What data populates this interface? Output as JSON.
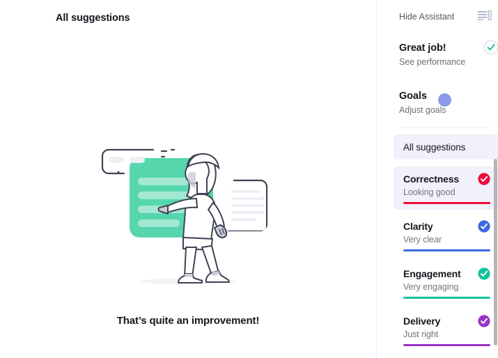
{
  "main": {
    "page_title": "All suggestions",
    "caption": "That’s quite an improvement!",
    "illustration_name": "woman-pointing-at-document-cards-illustration"
  },
  "sidebar": {
    "hide_assistant": {
      "label": "Hide Assistant",
      "icon": "panel-layout-icon"
    },
    "status_blocks": [
      {
        "id": "great-job",
        "title": "Great job!",
        "subtitle": "See performance",
        "icon": "check-circle-outline-icon",
        "icon_color": "#1fc39a"
      },
      {
        "id": "goals",
        "title": "Goals",
        "subtitle": "Adjust goals",
        "icon": "dot-icon",
        "icon_color": "#8a9ae8"
      }
    ],
    "all_suggestions": {
      "label": "All suggestions",
      "active": true
    },
    "metrics": [
      {
        "id": "correctness",
        "title": "Correctness",
        "subtitle": "Looking good",
        "badge": "check-badge-icon",
        "color": "#ed0c3a",
        "active": true
      },
      {
        "id": "clarity",
        "title": "Clarity",
        "subtitle": "Very clear",
        "badge": "check-badge-icon",
        "color": "#3d6ae0",
        "active": false
      },
      {
        "id": "engagement",
        "title": "Engagement",
        "subtitle": "Very engaging",
        "badge": "check-badge-icon",
        "color": "#15c39a",
        "active": false
      },
      {
        "id": "delivery",
        "title": "Delivery",
        "subtitle": "Just right",
        "badge": "check-badge-icon",
        "color": "#9b34c6",
        "active": false
      }
    ],
    "scrollbar": {
      "name": "sidebar-scrollbar"
    }
  },
  "colors": {
    "card_active_bg": "#f0f1fa",
    "panel_bg": "#ffffff",
    "text_primary": "#16161d",
    "text_secondary": "#6d6d77",
    "illustration_green": "#57d6ae",
    "illustration_outline": "#3f4252"
  }
}
